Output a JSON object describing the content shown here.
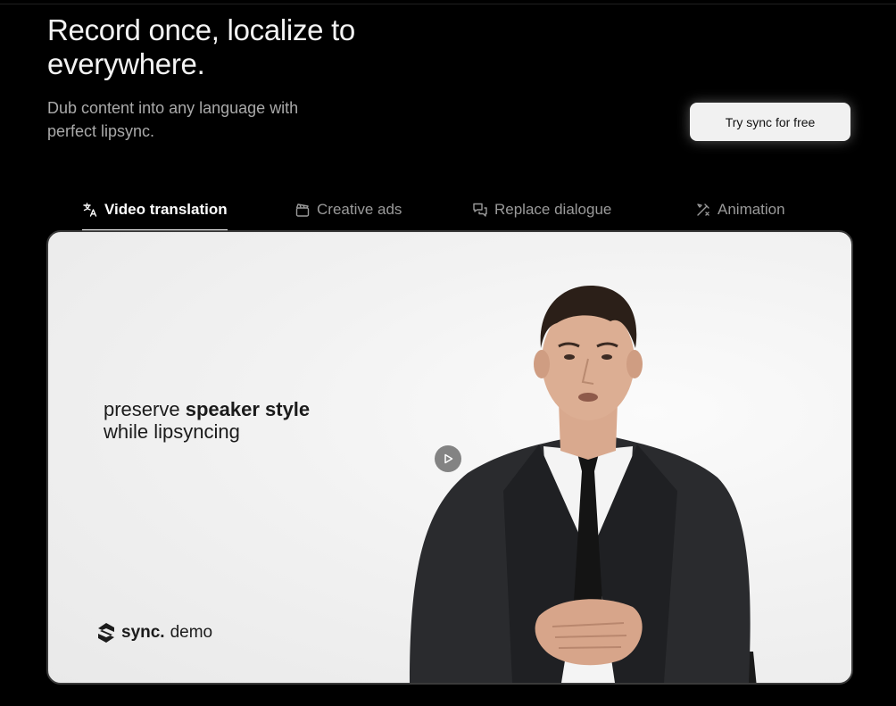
{
  "hero": {
    "title": "Record once, localize to everywhere.",
    "subtitle": "Dub content into any language with perfect lipsync."
  },
  "cta": {
    "label": "Try sync for free"
  },
  "tabs": [
    {
      "label": "Video translation",
      "icon": "translate-icon",
      "active": true
    },
    {
      "label": "Creative ads",
      "icon": "clapperboard-icon",
      "active": false
    },
    {
      "label": "Replace dialogue",
      "icon": "chat-bubbles-icon",
      "active": false
    },
    {
      "label": "Animation",
      "icon": "pen-tool-icon",
      "active": false
    }
  ],
  "video": {
    "caption_line1_normal": "preserve ",
    "caption_line1_bold": "speaker style",
    "caption_line2": "while lipsyncing",
    "badge_brand": "sync.",
    "badge_text": "demo",
    "play_icon": "play-icon"
  },
  "colors": {
    "background": "#000000",
    "title": "#f3f3f3",
    "subtitle": "#a9a9a9",
    "cta_bg": "#f1f1f1",
    "tab_active": "#ffffff",
    "tab_inactive": "#9a9a9a"
  }
}
